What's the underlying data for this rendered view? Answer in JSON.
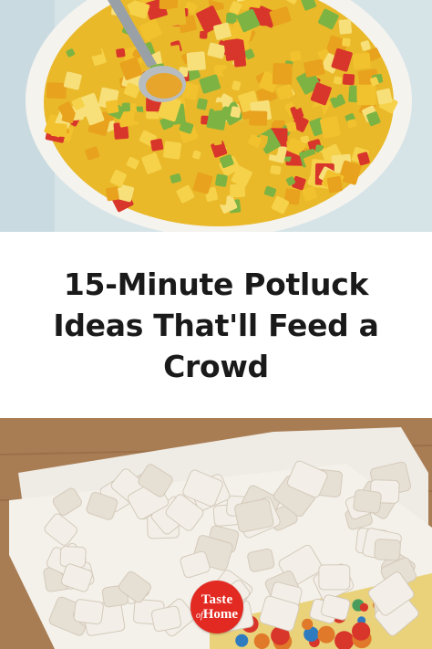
{
  "title": "15-Minute Potluck Ideas That'll Feed a Crowd",
  "logo": {
    "line1": "Taste",
    "of": "of",
    "line2": "Home",
    "color": "#e22a22"
  },
  "photos": {
    "top": {
      "subject": "mango salsa in white bowl with spoon"
    },
    "bottom": {
      "subject": "powdered sugar snack mix in decorative box"
    }
  },
  "colors": {
    "title": "#1a1a1a",
    "background": "#ffffff"
  }
}
